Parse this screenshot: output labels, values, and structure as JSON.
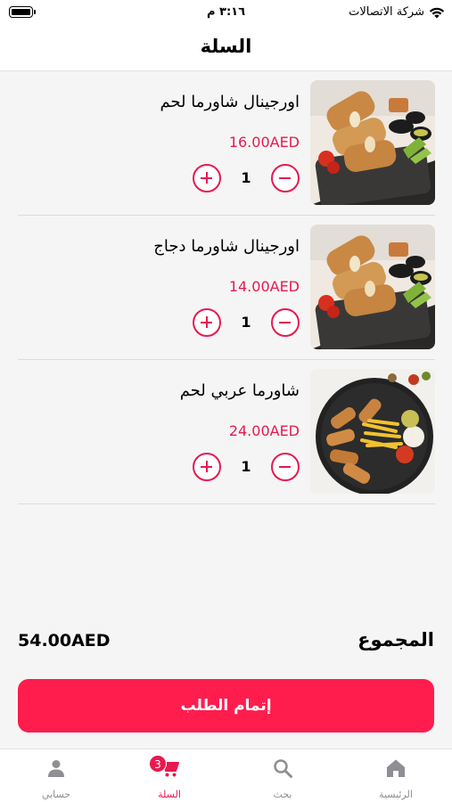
{
  "status_bar": {
    "time": "٣:١٦ م",
    "carrier": "شركة الاتصالات"
  },
  "header": {
    "title": "السلة"
  },
  "cart_items": [
    {
      "name": "اورجينال شاورما لحم",
      "price": "16.00AED",
      "quantity": "1"
    },
    {
      "name": "اورجينال شاورما دجاج",
      "price": "14.00AED",
      "quantity": "1"
    },
    {
      "name": "شاورما عربي لحم",
      "price": "24.00AED",
      "quantity": "1"
    }
  ],
  "total": {
    "label": "المجموع",
    "value": "54.00AED"
  },
  "checkout": {
    "label": "إتمام الطلب"
  },
  "tabbar": {
    "items": [
      {
        "label": "الرئيسية",
        "icon": "home-icon"
      },
      {
        "label": "بحث",
        "icon": "search-icon"
      },
      {
        "label": "السلة",
        "icon": "cart-icon",
        "badge": "3"
      },
      {
        "label": "حسابي",
        "icon": "user-icon"
      }
    ],
    "active_color": "#e8194f"
  },
  "colors": {
    "accent": "#e8194f",
    "button": "#ff1d4e"
  }
}
